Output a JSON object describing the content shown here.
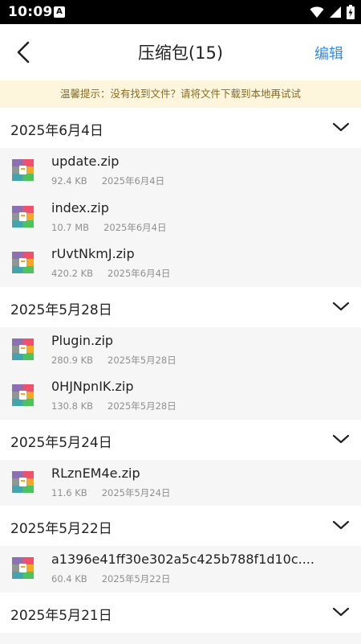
{
  "status_bar": {
    "time": "10:09",
    "a_badge": "A"
  },
  "app_bar": {
    "title": "压缩包(15)",
    "edit_label": "编辑"
  },
  "tip": {
    "text": "温馨提示：没有找到文件？请将文件下载到本地再试试"
  },
  "colors": {
    "accent": "#2d8cf0",
    "tip_bg": "#fdf6dc",
    "row_bg": "#f6f6f6"
  },
  "groups": [
    {
      "date": "2025年6月4日",
      "files": [
        {
          "name": "update.zip",
          "size": "92.4 KB",
          "date": "2025年6月4日"
        },
        {
          "name": "index.zip",
          "size": "10.7 MB",
          "date": "2025年6月4日"
        },
        {
          "name": "rUvtNkmJ.zip",
          "size": "420.2 KB",
          "date": "2025年6月4日"
        }
      ]
    },
    {
      "date": "2025年5月28日",
      "files": [
        {
          "name": "Plugin.zip",
          "size": "280.9 KB",
          "date": "2025年5月28日"
        },
        {
          "name": "0HJNpnIK.zip",
          "size": "130.8 KB",
          "date": "2025年5月28日"
        }
      ]
    },
    {
      "date": "2025年5月24日",
      "files": [
        {
          "name": "RLznEM4e.zip",
          "size": "11.6 KB",
          "date": "2025年5月24日"
        }
      ]
    },
    {
      "date": "2025年5月22日",
      "files": [
        {
          "name": "a1396e41ff30e302a5c425b788f1d10c....",
          "size": "60.4 KB",
          "date": "2025年5月22日"
        }
      ]
    },
    {
      "date": "2025年5月21日",
      "files": []
    }
  ]
}
